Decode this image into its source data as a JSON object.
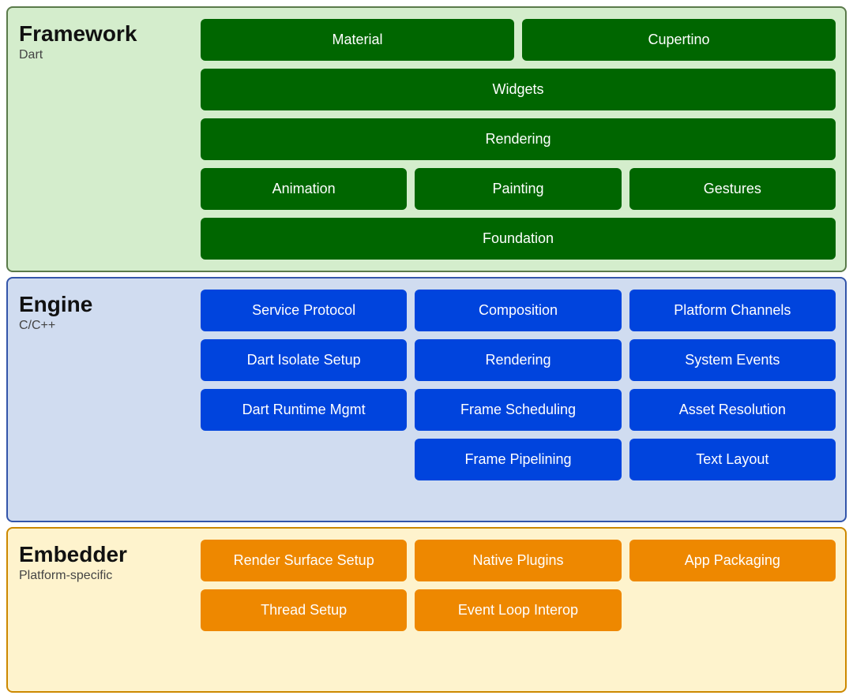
{
  "framework": {
    "title": "Framework",
    "subtitle": "Dart",
    "rows": [
      [
        {
          "label": "Material",
          "span": 1
        },
        {
          "label": "Cupertino",
          "span": 1
        }
      ],
      [
        {
          "label": "Widgets",
          "span": 2
        }
      ],
      [
        {
          "label": "Rendering",
          "span": 2
        }
      ],
      [
        {
          "label": "Animation",
          "span": 1
        },
        {
          "label": "Painting",
          "span": 1
        },
        {
          "label": "Gestures",
          "span": 1
        }
      ],
      [
        {
          "label": "Foundation",
          "span": 3
        }
      ]
    ]
  },
  "engine": {
    "title": "Engine",
    "subtitle": "C/C++",
    "rows": [
      [
        {
          "label": "Service Protocol"
        },
        {
          "label": "Composition"
        },
        {
          "label": "Platform Channels"
        }
      ],
      [
        {
          "label": "Dart Isolate Setup"
        },
        {
          "label": "Rendering"
        },
        {
          "label": "System Events"
        }
      ],
      [
        {
          "label": "Dart Runtime Mgmt"
        },
        {
          "label": "Frame Scheduling"
        },
        {
          "label": "Asset Resolution"
        }
      ],
      [
        {
          "label": "",
          "hidden": true
        },
        {
          "label": "Frame Pipelining"
        },
        {
          "label": "Text Layout"
        }
      ]
    ]
  },
  "embedder": {
    "title": "Embedder",
    "subtitle": "Platform-specific",
    "rows": [
      [
        {
          "label": "Render Surface Setup"
        },
        {
          "label": "Native Plugins"
        },
        {
          "label": "App Packaging"
        }
      ],
      [
        {
          "label": "Thread Setup"
        },
        {
          "label": "Event Loop Interop"
        },
        {
          "label": "",
          "hidden": true
        }
      ]
    ]
  }
}
